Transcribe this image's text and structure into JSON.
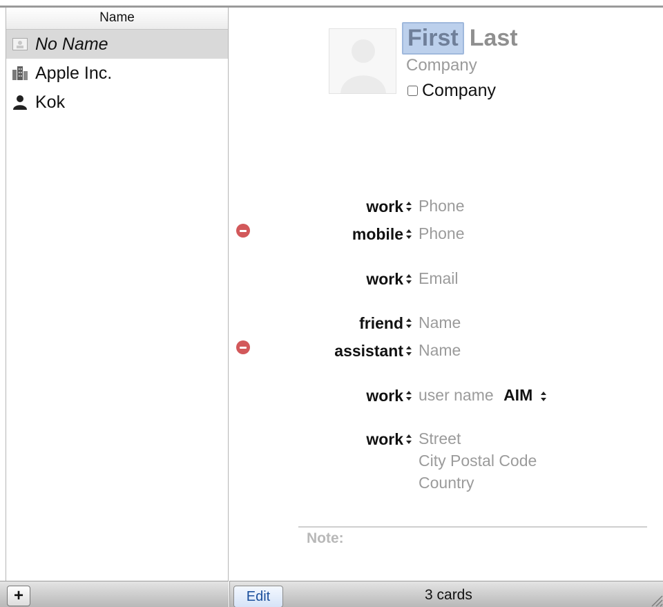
{
  "list": {
    "header": "Name",
    "items": [
      {
        "label": "No Name",
        "icon": "card-icon"
      },
      {
        "label": "Apple Inc.",
        "icon": "building-icon"
      },
      {
        "label": "Kok",
        "icon": "person-icon"
      }
    ]
  },
  "card": {
    "first": "First",
    "last": "Last",
    "company_placeholder": "Company",
    "company_checkbox_label": "Company",
    "fields": {
      "phone_work": {
        "label": "work",
        "placeholder": "Phone"
      },
      "phone_mobile": {
        "label": "mobile",
        "placeholder": "Phone"
      },
      "email_work": {
        "label": "work",
        "placeholder": "Email"
      },
      "related_friend": {
        "label": "friend",
        "placeholder": "Name"
      },
      "related_assistant": {
        "label": "assistant",
        "placeholder": "Name"
      },
      "im_work": {
        "label": "work",
        "placeholder": "user name",
        "service": "AIM"
      },
      "address_work": {
        "label": "work",
        "street": "Street",
        "city": "City Postal Code",
        "country": "Country"
      }
    },
    "note_label": "Note:"
  },
  "footer": {
    "add_label": "+",
    "edit_label": "Edit",
    "count": "3 cards"
  },
  "colors": {
    "minus_button": "#d2585a",
    "selection": "#d9d9d9",
    "name_highlight": "#bcd0ec"
  }
}
